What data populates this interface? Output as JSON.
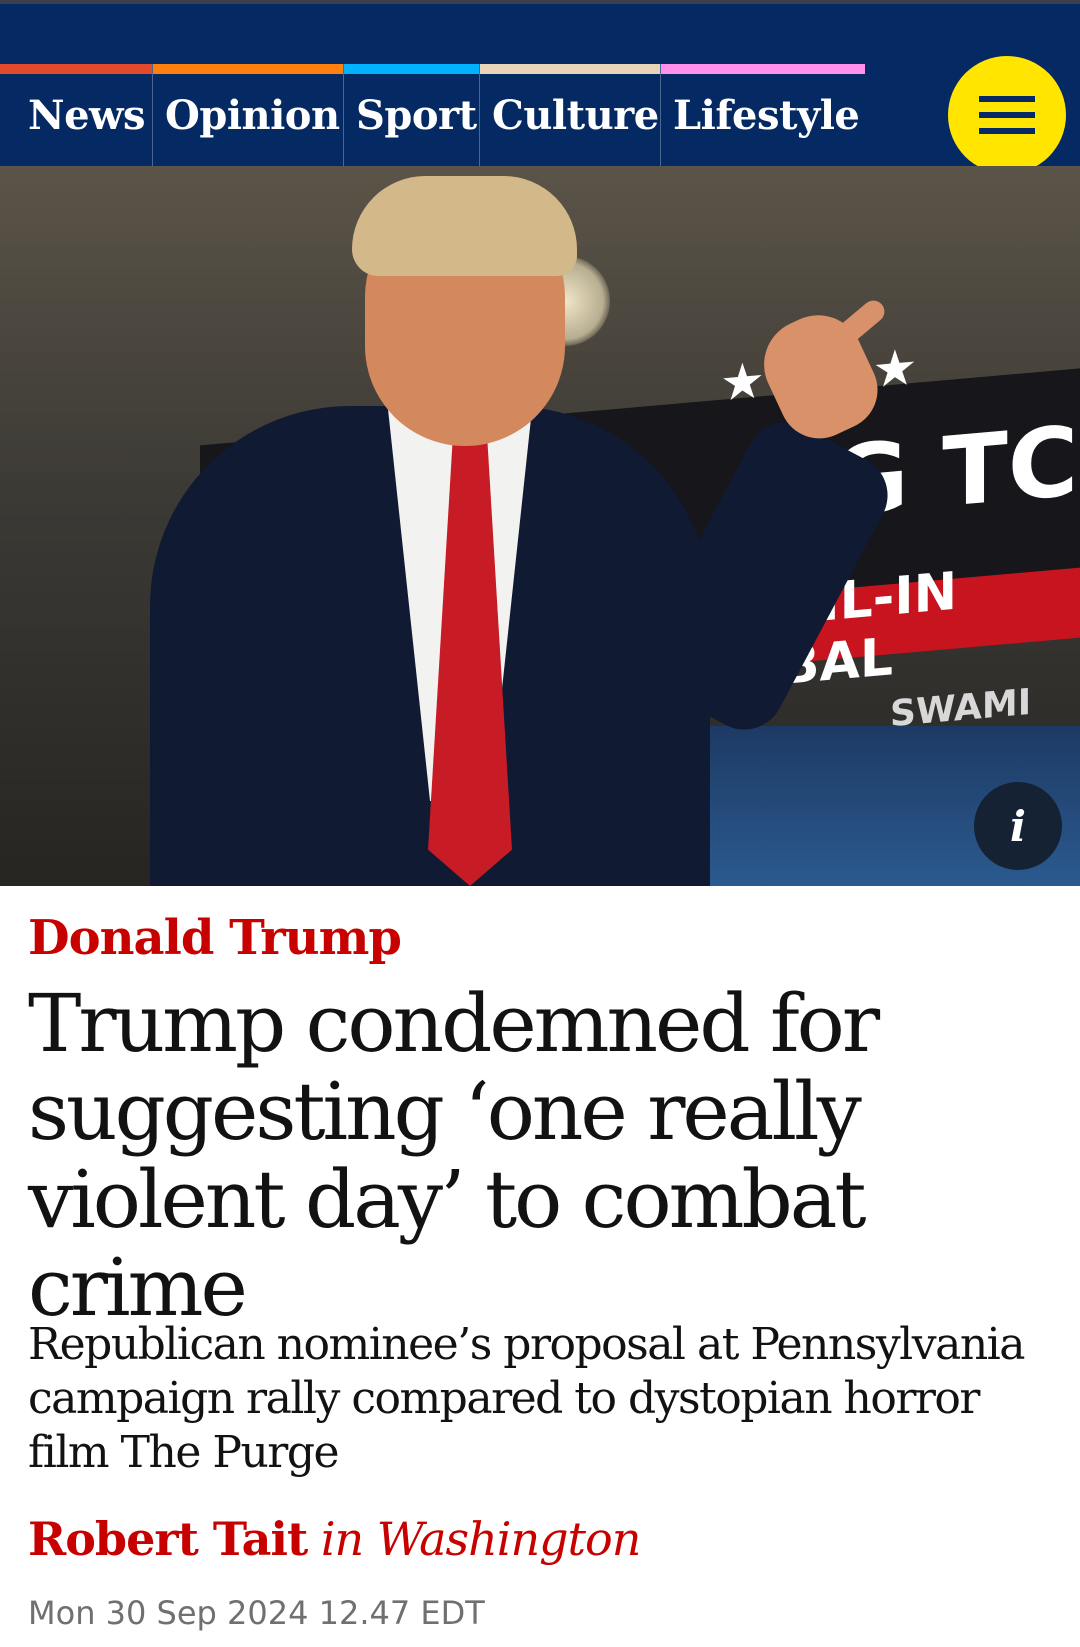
{
  "nav": {
    "pillars": [
      {
        "label": "News",
        "color": "#e3492b"
      },
      {
        "label": "Opinion",
        "color": "#ff7f0f"
      },
      {
        "label": "Sport",
        "color": "#00b2ff"
      },
      {
        "label": "Culture",
        "color": "#e7d4b9"
      },
      {
        "label": "Lifestyle",
        "color": "#ff91ec"
      }
    ],
    "menu_icon": "hamburger-menu-icon",
    "background": "#052962",
    "menu_button_color": "#ffe500"
  },
  "hero": {
    "info_icon": "info-icon",
    "info_label": "i"
  },
  "article": {
    "kicker": "Donald Trump",
    "headline": "Trump condemned for suggesting ‘one really violent day’ to combat crime",
    "standfirst": "Republican nominee’s proposal at Pennsylvania campaign rally compared to dystopian horror film The Purge",
    "byline_author": "Robert Tait",
    "byline_location": "in Washington",
    "date": "Mon 30 Sep 2024 12.47 EDT",
    "accent_color": "#c70000"
  }
}
